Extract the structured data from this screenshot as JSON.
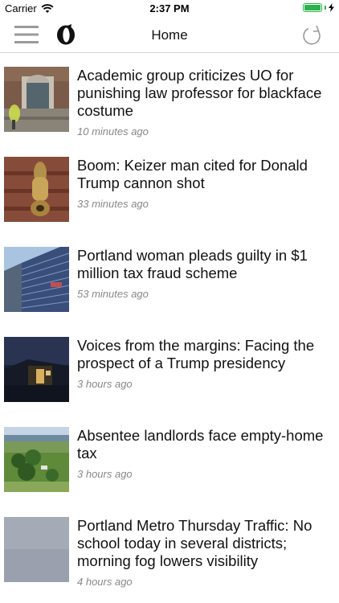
{
  "status_bar": {
    "carrier": "Carrier",
    "time": "2:37 PM",
    "battery_color": "#2bb24c"
  },
  "nav": {
    "title": "Home",
    "menu_icon": "hamburger-menu-icon",
    "logo_icon": "oregonian-logo-icon",
    "refresh_icon": "refresh-icon"
  },
  "articles": [
    {
      "headline": "Academic group criticizes UO for punishing law professor for blackface costume",
      "time": "10 minutes ago",
      "thumb": "campus-building"
    },
    {
      "headline": "Boom: Keizer man cited for Donald Trump cannon shot",
      "time": "33 minutes ago",
      "thumb": "brass-cannon"
    },
    {
      "headline": "Portland woman pleads guilty in $1 million tax fraud scheme",
      "time": "53 minutes ago",
      "thumb": "glass-tower"
    },
    {
      "headline": "Voices from the margins: Facing the prospect of a Trump presidency",
      "time": "3 hours ago",
      "thumb": "night-porch"
    },
    {
      "headline": "Absentee landlords face empty-home tax",
      "time": "3 hours ago",
      "thumb": "aerial-landscape"
    },
    {
      "headline": "Portland Metro Thursday Traffic: No school today in several districts; morning fog lowers visibility",
      "time": "4 hours ago",
      "thumb": "fog"
    }
  ]
}
